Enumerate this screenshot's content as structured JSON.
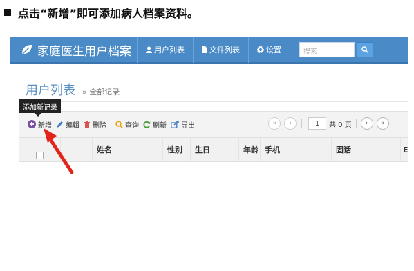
{
  "instruction": {
    "text": "点击“新增”即可添加病人档案资料。"
  },
  "navbar": {
    "brand": "家庭医生用户档案",
    "items": [
      {
        "label": "用户列表",
        "icon": "user-icon"
      },
      {
        "label": "文件列表",
        "icon": "file-icon"
      },
      {
        "label": "设置",
        "icon": "gear-icon"
      }
    ],
    "search_placeholder": "搜索",
    "colors": {
      "bar": "#4a8bc7",
      "search_button": "#5da3e1"
    }
  },
  "page": {
    "title": "用户列表",
    "breadcrumb": "» 全部记录"
  },
  "tooltip": {
    "text": "添加新记录"
  },
  "toolbar": {
    "add": "新增",
    "edit": "编辑",
    "delete": "删除",
    "query": "查询",
    "refresh": "刷新",
    "export": "导出"
  },
  "pager": {
    "current_page": "1",
    "total_text": "共 0 页"
  },
  "grid": {
    "columns": [
      "姓名",
      "性别",
      "生日",
      "年龄",
      "手机",
      "固话",
      "E"
    ]
  },
  "annotation": {
    "arrow_color": "#e3241b"
  }
}
